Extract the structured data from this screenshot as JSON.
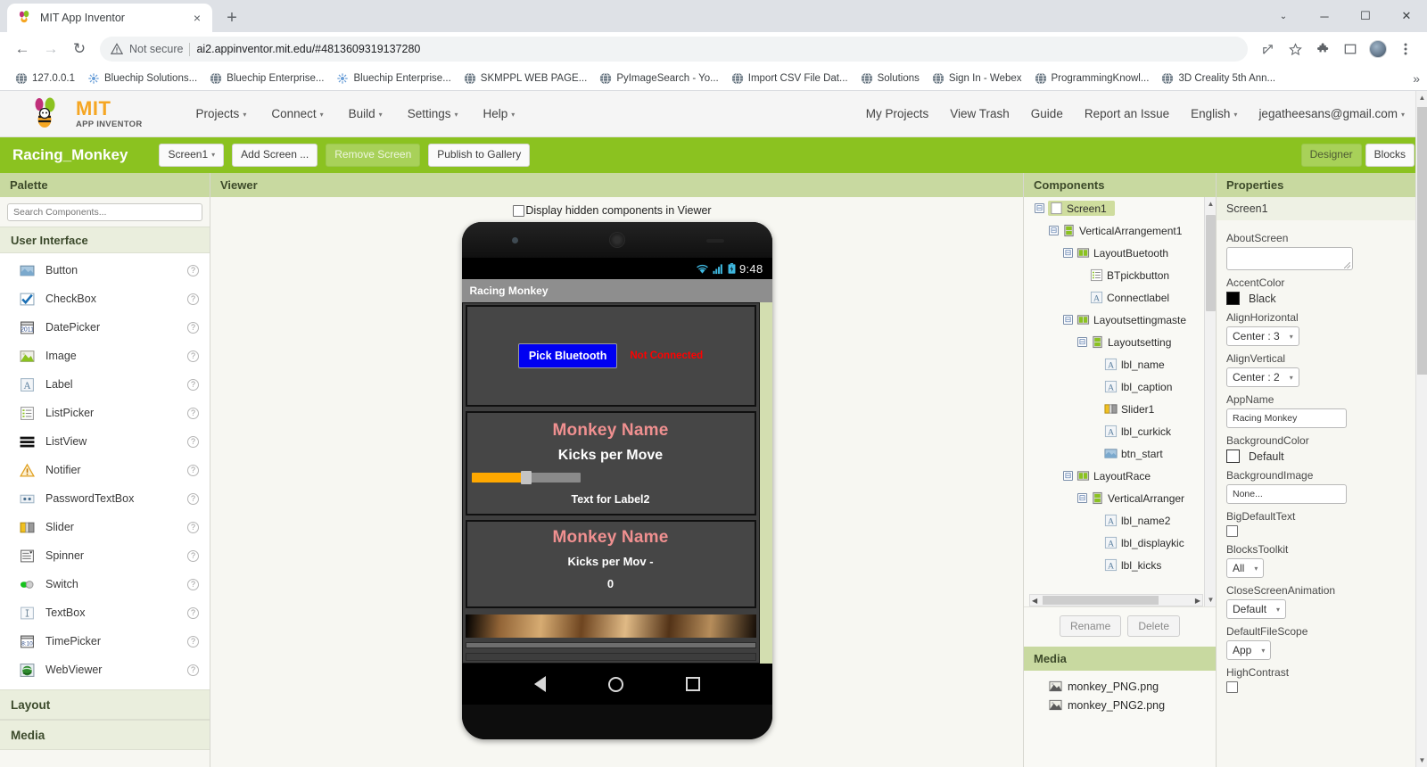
{
  "browser": {
    "tab": {
      "title": "MIT App Inventor",
      "favicon": "mit-app-inventor-favicon",
      "close_label": "×",
      "new_tab_label": "+"
    },
    "window_controls": {
      "chevron": "⌄",
      "minimize": "─",
      "maximize": "☐",
      "close": "✕"
    },
    "nav": {
      "back": "←",
      "forward": "→",
      "reload": "↻"
    },
    "omnibox": {
      "security_text": "Not secure",
      "url": "ai2.appinventor.mit.edu/#4813609319137280"
    },
    "toolbar_icons": [
      "share-icon",
      "bookmark-star-icon",
      "extensions-puzzle-icon",
      "sidepanel-icon",
      "profile-avatar",
      "chrome-menu-icon"
    ],
    "bookmarks": [
      {
        "label": "127.0.0.1",
        "icon": "globe-icon"
      },
      {
        "label": "Bluechip Solutions...",
        "icon": "site-icon"
      },
      {
        "label": "Bluechip Enterprise...",
        "icon": "globe-icon"
      },
      {
        "label": "Bluechip Enterprise...",
        "icon": "site-icon"
      },
      {
        "label": "SKMPPL WEB PAGE...",
        "icon": "globe-icon"
      },
      {
        "label": "PyImageSearch - Yo...",
        "icon": "globe-icon"
      },
      {
        "label": "Import CSV File Dat...",
        "icon": "globe-icon"
      },
      {
        "label": "Solutions",
        "icon": "globe-icon"
      },
      {
        "label": "Sign In - Webex",
        "icon": "globe-icon"
      },
      {
        "label": "ProgrammingKnowl...",
        "icon": "globe-icon"
      },
      {
        "label": "3D Creality 5th Ann...",
        "icon": "globe-icon"
      }
    ],
    "bookmarks_overflow": "»"
  },
  "appinventor": {
    "logo": {
      "mit": "MIT",
      "sub": "APP INVENTOR"
    },
    "menu": [
      {
        "label": "Projects",
        "caret": "▾"
      },
      {
        "label": "Connect",
        "caret": "▾"
      },
      {
        "label": "Build",
        "caret": "▾"
      },
      {
        "label": "Settings",
        "caret": "▾"
      },
      {
        "label": "Help",
        "caret": "▾"
      }
    ],
    "account_menu": [
      {
        "label": "My Projects",
        "caret": ""
      },
      {
        "label": "View Trash",
        "caret": ""
      },
      {
        "label": "Guide",
        "caret": ""
      },
      {
        "label": "Report an Issue",
        "caret": ""
      },
      {
        "label": "English",
        "caret": "▾"
      },
      {
        "label": "jegatheesans@gmail.com",
        "caret": "▾"
      }
    ],
    "project_bar": {
      "project_name": "Racing_Monkey",
      "screen_select": "Screen1",
      "screen_caret": "▾",
      "add_screen": "Add Screen ...",
      "remove_screen": "Remove Screen",
      "publish": "Publish to Gallery",
      "designer_tab": "Designer",
      "blocks_tab": "Blocks",
      "accent_green": "#8bc220"
    }
  },
  "palette": {
    "title": "Palette",
    "search_placeholder": "Search Components...",
    "category_user_interface": "User Interface",
    "items": [
      {
        "label": "Button",
        "icon": "button-icon",
        "help": "?"
      },
      {
        "label": "CheckBox",
        "icon": "checkbox-icon",
        "help": "?"
      },
      {
        "label": "DatePicker",
        "icon": "datepicker-icon",
        "help": "?"
      },
      {
        "label": "Image",
        "icon": "image-icon",
        "help": "?"
      },
      {
        "label": "Label",
        "icon": "label-icon",
        "help": "?"
      },
      {
        "label": "ListPicker",
        "icon": "listpicker-icon",
        "help": "?"
      },
      {
        "label": "ListView",
        "icon": "listview-icon",
        "help": "?"
      },
      {
        "label": "Notifier",
        "icon": "notifier-warning-icon",
        "help": "?"
      },
      {
        "label": "PasswordTextBox",
        "icon": "passwordtextbox-icon",
        "help": "?"
      },
      {
        "label": "Slider",
        "icon": "slider-icon",
        "help": "?"
      },
      {
        "label": "Spinner",
        "icon": "spinner-icon",
        "help": "?"
      },
      {
        "label": "Switch",
        "icon": "switch-icon",
        "help": "?"
      },
      {
        "label": "TextBox",
        "icon": "textbox-icon",
        "help": "?"
      },
      {
        "label": "TimePicker",
        "icon": "timepicker-icon",
        "help": "?"
      },
      {
        "label": "WebViewer",
        "icon": "webviewer-icon",
        "help": "?"
      }
    ],
    "category_layout": "Layout",
    "category_media": "Media"
  },
  "viewer": {
    "title": "Viewer",
    "hidden_components_label": "Display hidden components in Viewer",
    "hidden_components_checked": false,
    "phone": {
      "status_time": "9:48",
      "status_icons": [
        "wifi-icon",
        "signal-icon",
        "battery-icon"
      ],
      "app_title": "Racing Monkey",
      "bluetooth_button": "Pick Bluetooth",
      "connect_label": "Not Connected",
      "connect_color": "#ff0000",
      "bluetooth_button_bg": "#0000f2",
      "setting": {
        "name_label": "Monkey Name",
        "caption_label": "Kicks per Move",
        "slider_value_pct": 45,
        "slider_fill_color": "#ffa800",
        "curkick_label": "Text for Label2"
      },
      "race": {
        "name_label": "Monkey Name",
        "display_label": "Kicks per Mov -",
        "kicks_label": "0",
        "monkey_image": "monkey-blur-image"
      },
      "nav": {
        "back": "back-triangle",
        "home": "home-circle",
        "recent": "recent-square"
      }
    }
  },
  "components": {
    "title": "Components",
    "tree": [
      {
        "label": "Screen1",
        "depth": 0,
        "toggle": "⊟",
        "icon": "screen-icon",
        "selected": true
      },
      {
        "label": "VerticalArrangement1",
        "depth": 1,
        "toggle": "⊟",
        "icon": "vertical-arrangement-icon",
        "selected": false
      },
      {
        "label": "LayoutBuetooth",
        "depth": 2,
        "toggle": "⊟",
        "icon": "horizontal-arrangement-icon",
        "selected": false
      },
      {
        "label": "BTpickbutton",
        "depth": 4,
        "toggle": "",
        "icon": "listpicker-icon",
        "selected": false
      },
      {
        "label": "Connectlabel",
        "depth": 4,
        "toggle": "",
        "icon": "label-icon",
        "selected": false
      },
      {
        "label": "Layoutsettingmaste",
        "depth": 2,
        "toggle": "⊟",
        "icon": "horizontal-arrangement-icon",
        "selected": false
      },
      {
        "label": "Layoutsetting",
        "depth": 3,
        "toggle": "⊟",
        "icon": "vertical-arrangement-icon",
        "selected": false
      },
      {
        "label": "lbl_name",
        "depth": 5,
        "toggle": "",
        "icon": "label-icon",
        "selected": false
      },
      {
        "label": "lbl_caption",
        "depth": 5,
        "toggle": "",
        "icon": "label-icon",
        "selected": false
      },
      {
        "label": "Slider1",
        "depth": 5,
        "toggle": "",
        "icon": "slider-icon",
        "selected": false
      },
      {
        "label": "lbl_curkick",
        "depth": 5,
        "toggle": "",
        "icon": "label-icon",
        "selected": false
      },
      {
        "label": "btn_start",
        "depth": 5,
        "toggle": "",
        "icon": "button-icon",
        "selected": false
      },
      {
        "label": "LayoutRace",
        "depth": 2,
        "toggle": "⊟",
        "icon": "horizontal-arrangement-icon",
        "selected": false
      },
      {
        "label": "VerticalArranger",
        "depth": 3,
        "toggle": "⊟",
        "icon": "vertical-arrangement-icon",
        "selected": false
      },
      {
        "label": "lbl_name2",
        "depth": 5,
        "toggle": "",
        "icon": "label-icon",
        "selected": false
      },
      {
        "label": "lbl_displaykic",
        "depth": 5,
        "toggle": "",
        "icon": "label-icon",
        "selected": false
      },
      {
        "label": "lbl_kicks",
        "depth": 5,
        "toggle": "",
        "icon": "label-icon",
        "selected": false
      }
    ],
    "rename_button": "Rename",
    "delete_button": "Delete",
    "hscroll_left": "◀",
    "hscroll_right": "▶"
  },
  "media": {
    "title": "Media",
    "files": [
      {
        "label": "monkey_PNG.png",
        "icon": "image-file-icon"
      },
      {
        "label": "monkey_PNG2.png",
        "icon": "image-file-icon"
      }
    ]
  },
  "properties": {
    "title": "Properties",
    "selected_component": "Screen1",
    "fields": [
      {
        "name": "AboutScreen",
        "type": "textarea",
        "value": ""
      },
      {
        "name": "AccentColor",
        "type": "color",
        "value": "Black",
        "swatch": "#000000"
      },
      {
        "name": "AlignHorizontal",
        "type": "select",
        "value": "Center : 3"
      },
      {
        "name": "AlignVertical",
        "type": "select",
        "value": "Center : 2"
      },
      {
        "name": "AppName",
        "type": "input",
        "value": "Racing Monkey"
      },
      {
        "name": "BackgroundColor",
        "type": "color",
        "value": "Default",
        "swatch": "#ffffff"
      },
      {
        "name": "BackgroundImage",
        "type": "input",
        "value": "None..."
      },
      {
        "name": "BigDefaultText",
        "type": "checkbox",
        "value": false
      },
      {
        "name": "BlocksToolkit",
        "type": "select",
        "value": "All"
      },
      {
        "name": "CloseScreenAnimation",
        "type": "select",
        "value": "Default"
      },
      {
        "name": "DefaultFileScope",
        "type": "select",
        "value": "App"
      },
      {
        "name": "HighContrast",
        "type": "checkbox",
        "value": false
      }
    ],
    "caret": "▾"
  }
}
